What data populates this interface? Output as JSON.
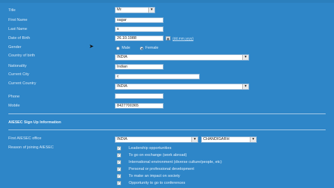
{
  "form": {
    "title_label": "Title",
    "title_value": "Mr",
    "first_name_label": "First Name",
    "first_name_value": "sagar",
    "last_name_label": "Last Name",
    "last_name_value": "s",
    "dob_label": "Date of Birth",
    "dob_value": "26.10.1988",
    "dob_hint": "(dd.mm.yyyy)",
    "gender_label": "Gender",
    "gender_male": "Male",
    "gender_female": "Female",
    "country_birth_label": "Country of birth",
    "country_birth_value": "INDIA",
    "nationality_label": "Nationality",
    "nationality_value": "Indian",
    "current_city_label": "Current City",
    "current_city_value": "c",
    "current_country_label": "Current Country",
    "current_country_value": "INDIA",
    "phone_label": "Phone",
    "phone_value": "",
    "mobile_label": "Mobile",
    "mobile_value": "8427700365"
  },
  "signup": {
    "section_title": "AIESEC Sign Up Information",
    "first_office_label": "First AIESEC office",
    "office_country_value": "INDIA",
    "office_city_value": "CHANDIGARH",
    "reason_label": "Reason of joining AIESEC",
    "reasons": [
      {
        "label": "Leadership opportunities",
        "checked": true
      },
      {
        "label": "To go on exchange (work abroad)",
        "checked": true
      },
      {
        "label": "International environment (diverse culture/people, etc)",
        "checked": true
      },
      {
        "label": "Personal or professional development",
        "checked": true
      },
      {
        "label": "To make an impact on society",
        "checked": true
      },
      {
        "label": "Opportunity to go to conferences",
        "checked": true
      }
    ]
  },
  "colors": {
    "background": "#2e86c8",
    "field": "#ffffff"
  }
}
